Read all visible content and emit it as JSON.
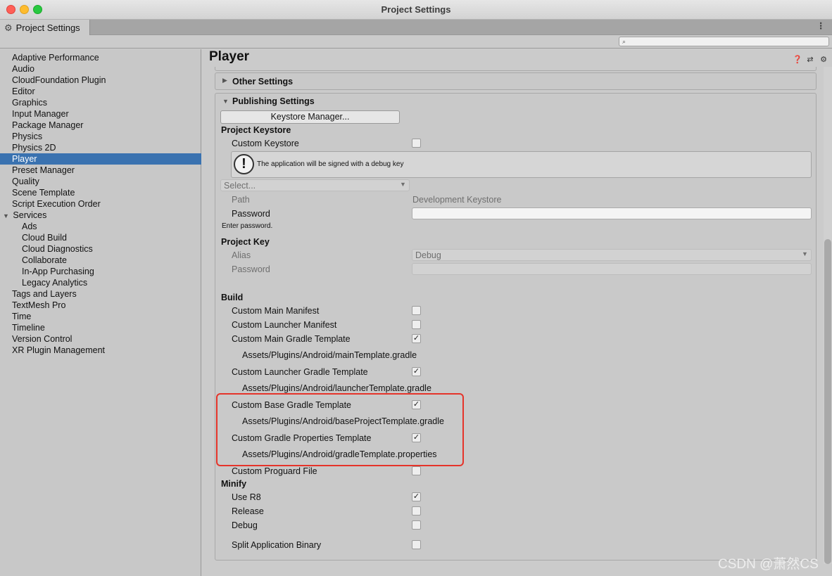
{
  "window": {
    "title": "Project Settings"
  },
  "tab": {
    "label": "Project Settings",
    "menu_glyph": "⋮"
  },
  "search": {
    "placeholder": "",
    "icon": "search-icon"
  },
  "sidebar": {
    "items": [
      "Adaptive Performance",
      "Audio",
      "CloudFoundation Plugin",
      "Editor",
      "Graphics",
      "Input Manager",
      "Package Manager",
      "Physics",
      "Physics 2D",
      "Player",
      "Preset Manager",
      "Quality",
      "Scene Template",
      "Script Execution Order",
      "Services",
      "Ads",
      "Cloud Build",
      "Cloud Diagnostics",
      "Collaborate",
      "In-App Purchasing",
      "Legacy Analytics",
      "Tags and Layers",
      "TextMesh Pro",
      "Time",
      "Timeline",
      "Version Control",
      "XR Plugin Management"
    ],
    "selected": "Player"
  },
  "main": {
    "title": "Player",
    "other_settings": "Other Settings",
    "publishing_settings": "Publishing Settings",
    "keystore_manager_button": "Keystore Manager...",
    "project_keystore": "Project Keystore",
    "custom_keystore": "Custom Keystore",
    "debug_key_notice": "The application will be signed with a debug key",
    "select_placeholder": "Select...",
    "path_label": "Path",
    "path_value": "Development Keystore",
    "password_label": "Password",
    "enter_password_hint": "Enter password.",
    "project_key": "Project Key",
    "alias_label": "Alias",
    "alias_value": "Debug",
    "key_password_label": "Password",
    "build_header": "Build",
    "build": {
      "custom_main_manifest": "Custom Main Manifest",
      "custom_launcher_manifest": "Custom Launcher Manifest",
      "custom_main_gradle_template": "Custom Main Gradle Template",
      "main_template_path": "Assets/Plugins/Android/mainTemplate.gradle",
      "custom_launcher_gradle_template": "Custom Launcher Gradle Template",
      "launcher_template_path": "Assets/Plugins/Android/launcherTemplate.gradle",
      "custom_base_gradle_template": "Custom Base Gradle Template",
      "base_template_path": "Assets/Plugins/Android/baseProjectTemplate.gradle",
      "custom_gradle_properties_template": "Custom Gradle Properties Template",
      "gradle_properties_path": "Assets/Plugins/Android/gradleTemplate.properties",
      "custom_proguard_file": "Custom Proguard File"
    },
    "minify_header": "Minify",
    "minify": {
      "use_r8": "Use R8",
      "release": "Release",
      "debug": "Debug"
    },
    "split_application_binary": "Split Application Binary",
    "checkbox_states": {
      "custom_keystore": false,
      "custom_main_manifest": false,
      "custom_launcher_manifest": false,
      "custom_main_gradle_template": true,
      "custom_launcher_gradle_template": true,
      "custom_base_gradle_template": true,
      "custom_gradle_properties_template": true,
      "custom_proguard_file": false,
      "use_r8": true,
      "release": false,
      "debug": false,
      "split_application_binary": false
    },
    "check_glyph": "✓"
  },
  "watermark": "CSDN @萧然CS",
  "colors": {
    "selection": "#3a72b0",
    "highlight_box": "#e5342a"
  }
}
